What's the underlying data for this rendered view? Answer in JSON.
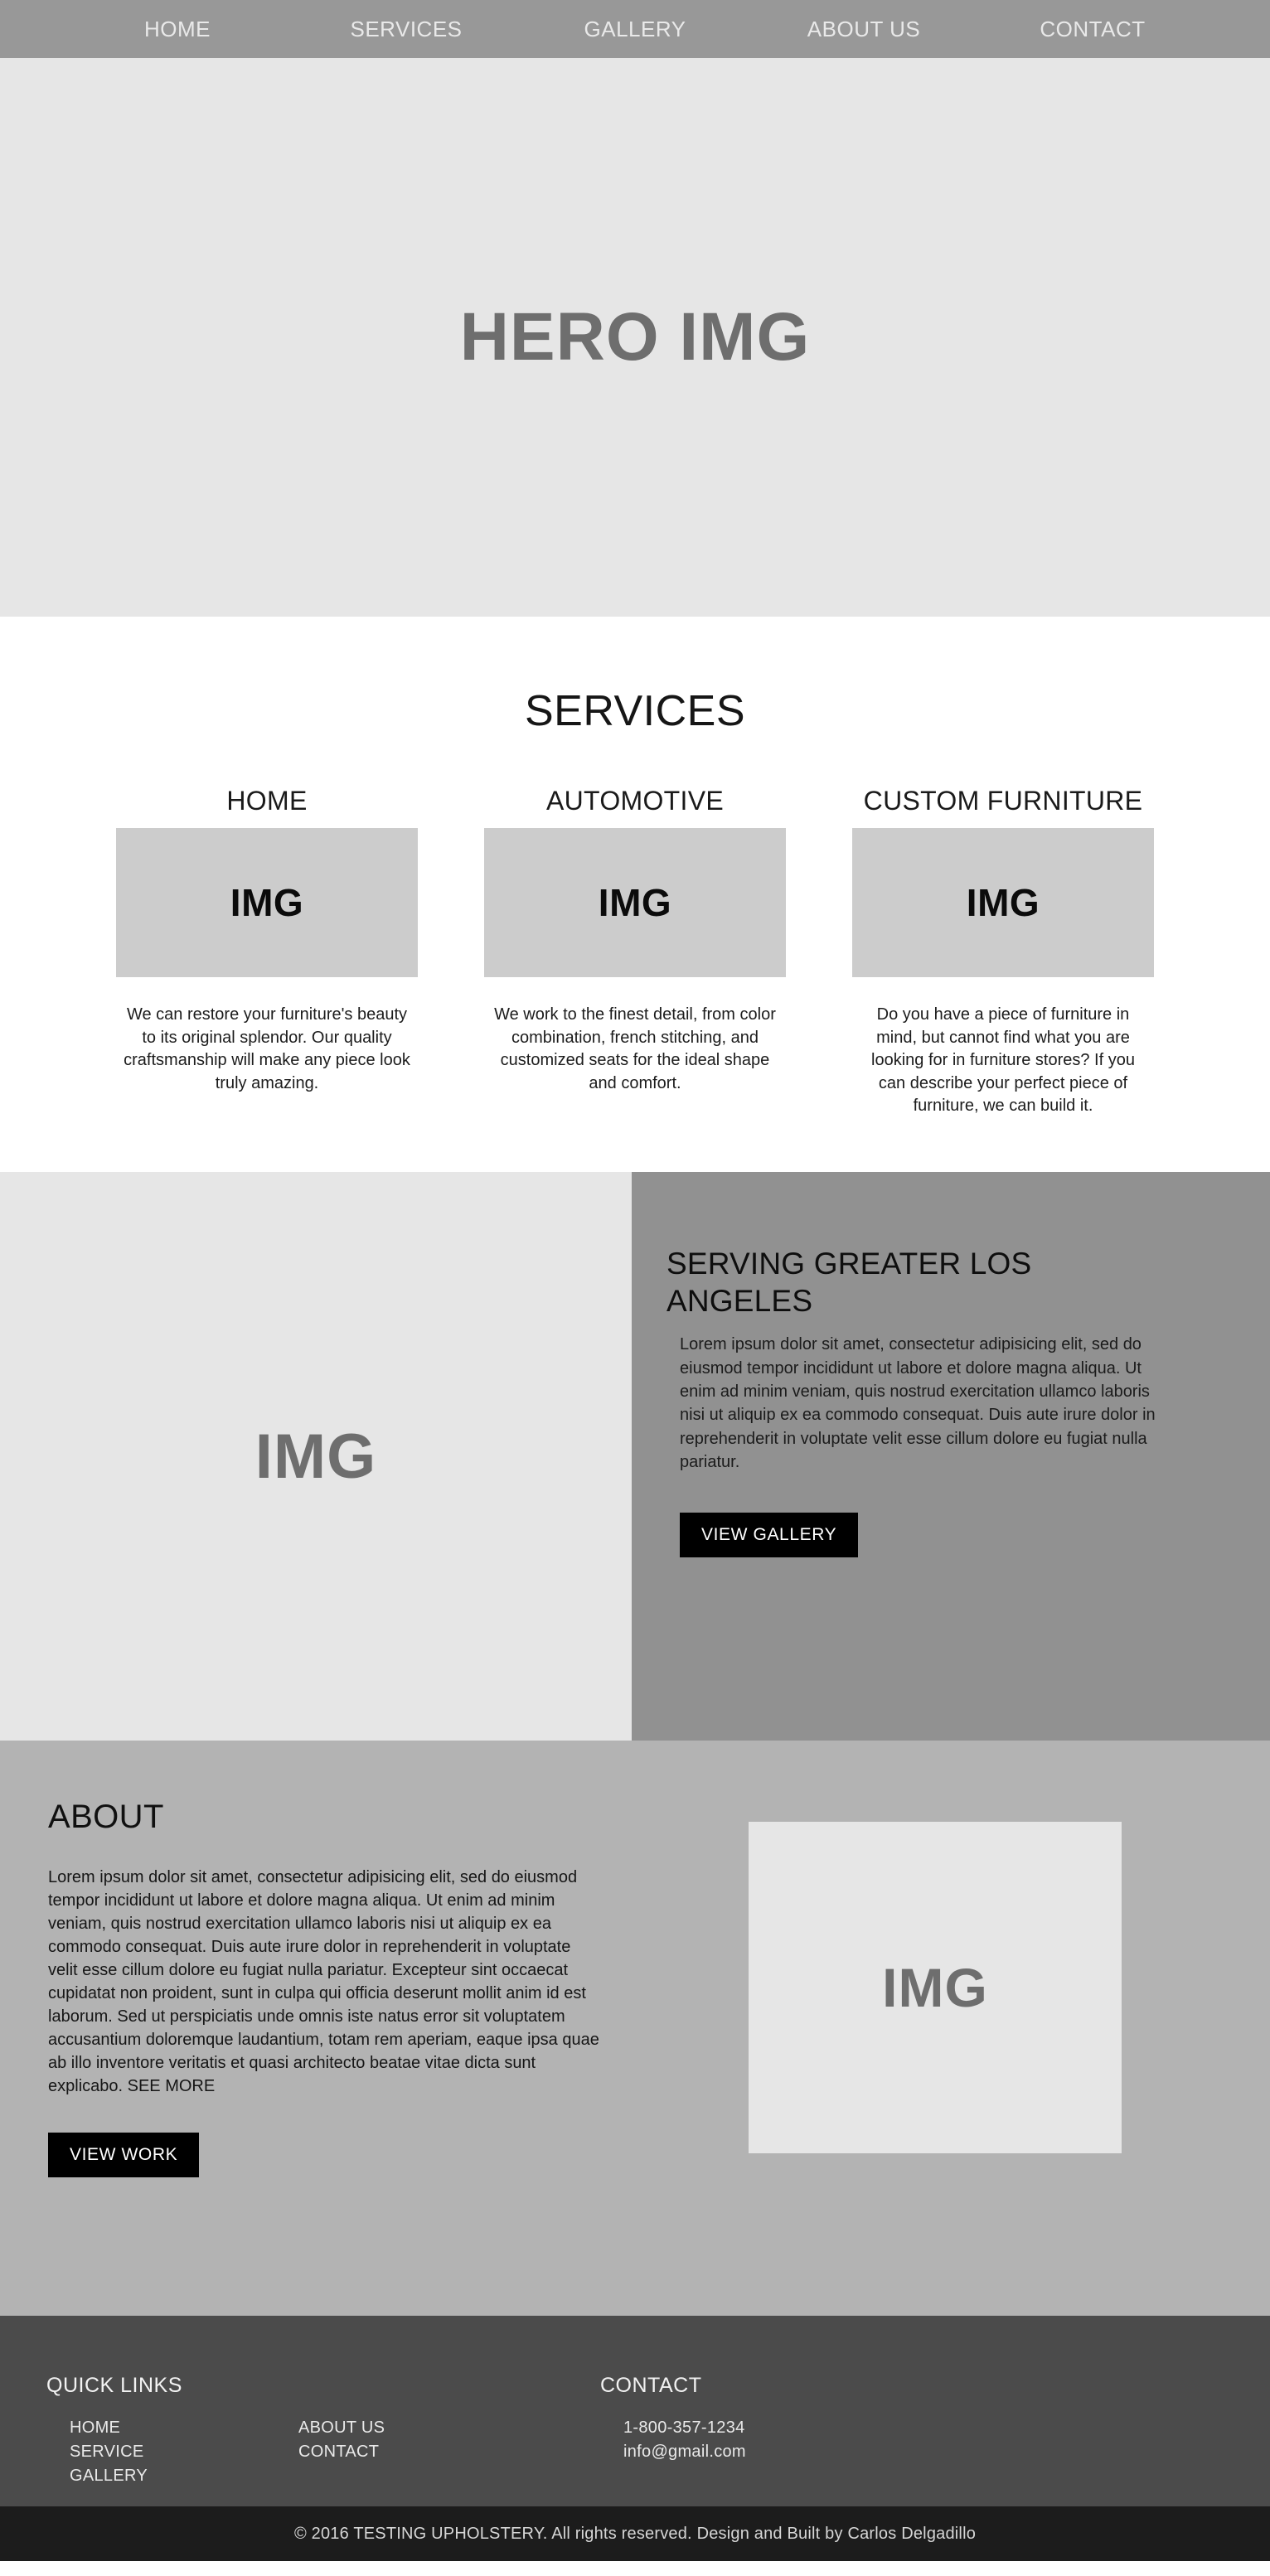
{
  "nav": {
    "items": [
      {
        "label": "HOME"
      },
      {
        "label": "SERVICES"
      },
      {
        "label": "GALLERY"
      },
      {
        "label": "ABOUT  US"
      },
      {
        "label": "CONTACT"
      }
    ]
  },
  "hero": {
    "title": "HERO IMG"
  },
  "services": {
    "title": "SERVICES",
    "cards": [
      {
        "title": "HOME",
        "image_label": "IMG",
        "text": "We can restore your furniture's beauty to its original splendor. Our quality craftsmanship will make any piece look truly amazing."
      },
      {
        "title": "AUTOMOTIVE",
        "image_label": "IMG",
        "text": "We work to the finest detail, from color combination, french stitching, and customized seats for the ideal shape and comfort."
      },
      {
        "title": "CUSTOM FURNITURE",
        "image_label": "IMG",
        "text": "Do you have a piece of furniture in mind, but cannot find what you are looking for in furniture stores? If you can describe your perfect piece of furniture, we can build it."
      }
    ]
  },
  "serving": {
    "image_label": "IMG",
    "heading": "SERVING GREATER LOS ANGELES",
    "paragraph": "Lorem ipsum dolor sit amet, consectetur adipisicing elit, sed do eiusmod tempor incididunt ut labore et dolore magna aliqua. Ut enim ad minim veniam, quis nostrud exercitation ullamco laboris nisi ut aliquip ex ea commodo consequat. Duis aute irure dolor in reprehenderit in voluptate velit esse cillum dolore eu fugiat nulla pariatur.",
    "button_label": "VIEW GALLERY"
  },
  "about": {
    "title": "ABOUT",
    "paragraph": "Lorem ipsum dolor sit amet, consectetur adipisicing elit, sed do eiusmod tempor incididunt ut labore et dolore magna aliqua. Ut enim ad minim veniam, quis nostrud exercitation ullamco laboris nisi ut aliquip ex ea commodo consequat. Duis aute irure dolor in reprehenderit in voluptate velit esse cillum dolore eu fugiat nulla pariatur. Excepteur sint occaecat cupidatat non proident, sunt in culpa qui officia deserunt mollit anim id est laborum. Sed ut perspiciatis unde omnis iste natus error sit voluptatem accusantium doloremque laudantium, totam rem aperiam, eaque ipsa quae ab illo inventore veritatis et quasi architecto beatae vitae dicta sunt explicabo. SEE MORE",
    "button_label": "VIEW WORK",
    "image_label": "IMG"
  },
  "footer": {
    "quick_links_heading": "QUICK LINKS",
    "quick_links_col1": [
      {
        "label": "HOME"
      },
      {
        "label": "SERVICE"
      },
      {
        "label": "GALLERY"
      }
    ],
    "quick_links_col2": [
      {
        "label": "ABOUT US"
      },
      {
        "label": "CONTACT"
      }
    ],
    "contact_heading": "CONTACT",
    "phone": "1-800-357-1234",
    "email": "info@gmail.com",
    "copyright": "© 2016 TESTING UPHOLSTERY. All rights reserved. Design and Built by Carlos Delgadillo"
  },
  "colors": {
    "nav_bg": "#989898",
    "hero_bg": "#e6e6e6",
    "serving_bg": "#919191",
    "about_bg": "#b3b3b3",
    "footer_bg": "#4b4b4b",
    "copyright_bg": "#1c1c1c",
    "button_bg": "#000000",
    "card_img_bg": "#cccccc"
  }
}
